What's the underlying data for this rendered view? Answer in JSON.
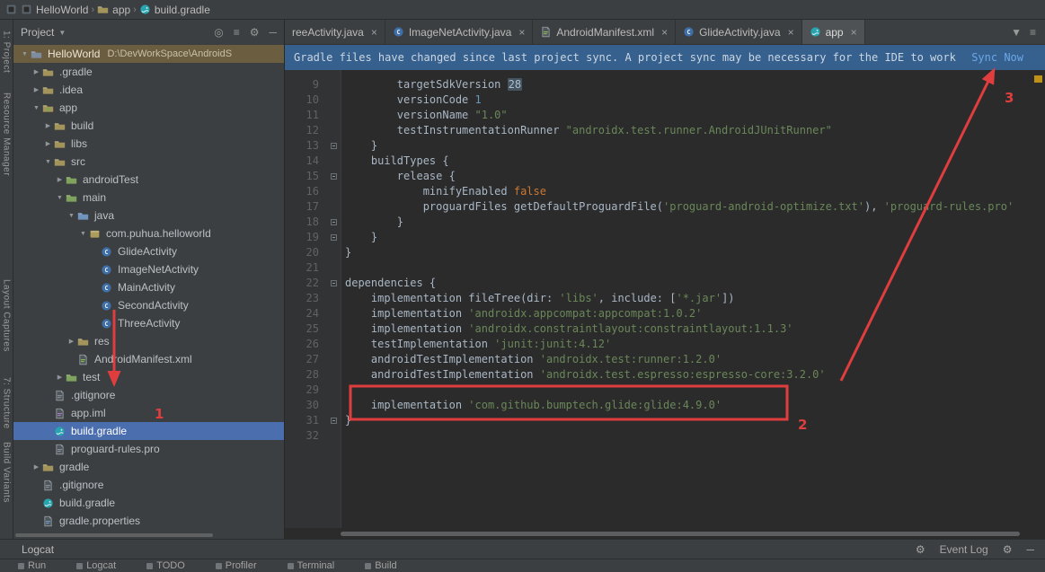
{
  "breadcrumb": {
    "items": [
      {
        "label": "HelloWorld",
        "icon": "project"
      },
      {
        "label": "app",
        "icon": "folder"
      },
      {
        "label": "build.gradle",
        "icon": "gradle"
      }
    ]
  },
  "left_strip": {
    "items": [
      "1: Project",
      "Resource Manager",
      "Layout Captures",
      "7: Structure",
      "Build Variants"
    ]
  },
  "project_panel": {
    "title": "Project",
    "tree": [
      {
        "label": "HelloWorld",
        "suffix": "D:\\DevWorkSpace\\AndroidS",
        "level": 0,
        "icon": "project-folder",
        "arrow": "down",
        "state": "context"
      },
      {
        "label": ".gradle",
        "level": 1,
        "icon": "folder",
        "arrow": "right"
      },
      {
        "label": ".idea",
        "level": 1,
        "icon": "folder",
        "arrow": "right"
      },
      {
        "label": "app",
        "level": 1,
        "icon": "module-folder",
        "arrow": "down"
      },
      {
        "label": "build",
        "level": 2,
        "icon": "folder",
        "arrow": "right"
      },
      {
        "label": "libs",
        "level": 2,
        "icon": "folder",
        "arrow": "right"
      },
      {
        "label": "src",
        "level": 2,
        "icon": "folder",
        "arrow": "down"
      },
      {
        "label": "androidTest",
        "level": 3,
        "icon": "folder-green",
        "arrow": "right"
      },
      {
        "label": "main",
        "level": 3,
        "icon": "folder-green",
        "arrow": "down"
      },
      {
        "label": "java",
        "level": 4,
        "icon": "folder-blue",
        "arrow": "down"
      },
      {
        "label": "com.puhua.helloworld",
        "level": 5,
        "icon": "package",
        "arrow": "down"
      },
      {
        "label": "GlideActivity",
        "level": 6,
        "icon": "class"
      },
      {
        "label": "ImageNetActivity",
        "level": 6,
        "icon": "class"
      },
      {
        "label": "MainActivity",
        "level": 6,
        "icon": "class"
      },
      {
        "label": "SecondActivity",
        "level": 6,
        "icon": "class"
      },
      {
        "label": "ThreeActivity",
        "level": 6,
        "icon": "class"
      },
      {
        "label": "res",
        "level": 4,
        "icon": "folder",
        "arrow": "right"
      },
      {
        "label": "AndroidManifest.xml",
        "level": 4,
        "icon": "manifest"
      },
      {
        "label": "test",
        "level": 3,
        "icon": "folder-green",
        "arrow": "right"
      },
      {
        "label": ".gitignore",
        "level": 2,
        "icon": "file"
      },
      {
        "label": "app.iml",
        "level": 2,
        "icon": "iml"
      },
      {
        "label": "build.gradle",
        "level": 2,
        "icon": "gradle",
        "state": "selected"
      },
      {
        "label": "proguard-rules.pro",
        "level": 2,
        "icon": "file"
      },
      {
        "label": "gradle",
        "level": 1,
        "icon": "folder",
        "arrow": "right"
      },
      {
        "label": ".gitignore",
        "level": 1,
        "icon": "file"
      },
      {
        "label": "build.gradle",
        "level": 1,
        "icon": "gradle"
      },
      {
        "label": "gradle.properties",
        "level": 1,
        "icon": "properties"
      }
    ]
  },
  "tabs": {
    "items": [
      {
        "label": "reeActivity.java",
        "icon": null,
        "active": false
      },
      {
        "label": "ImageNetActivity.java",
        "icon": "class",
        "active": false
      },
      {
        "label": "AndroidManifest.xml",
        "icon": "manifest",
        "active": false
      },
      {
        "label": "GlideActivity.java",
        "icon": "class",
        "active": false
      },
      {
        "label": "app",
        "icon": "gradle",
        "active": true
      }
    ]
  },
  "banner": {
    "message": "Gradle files have changed since last project sync. A project sync may be necessary for the IDE to work pr...",
    "action": "Sync Now"
  },
  "editor": {
    "lines": [
      {
        "no": 9,
        "fold": false,
        "segments": [
          [
            "plain",
            "        targetSdkVersion "
          ],
          [
            "hl",
            "28"
          ]
        ]
      },
      {
        "no": 10,
        "fold": false,
        "segments": [
          [
            "plain",
            "        versionCode "
          ],
          [
            "num",
            "1"
          ]
        ]
      },
      {
        "no": 11,
        "fold": false,
        "segments": [
          [
            "plain",
            "        versionName "
          ],
          [
            "str",
            "\"1.0\""
          ]
        ]
      },
      {
        "no": 12,
        "fold": false,
        "segments": [
          [
            "plain",
            "        testInstrumentationRunner "
          ],
          [
            "str",
            "\"androidx.test.runner.AndroidJUnitRunner\""
          ]
        ]
      },
      {
        "no": 13,
        "fold": true,
        "segments": [
          [
            "plain",
            "    }"
          ]
        ]
      },
      {
        "no": 14,
        "fold": false,
        "segments": [
          [
            "plain",
            "    buildTypes {"
          ]
        ]
      },
      {
        "no": 15,
        "fold": true,
        "segments": [
          [
            "plain",
            "        release {"
          ]
        ]
      },
      {
        "no": 16,
        "fold": false,
        "segments": [
          [
            "plain",
            "            minifyEnabled "
          ],
          [
            "kw",
            "false"
          ]
        ]
      },
      {
        "no": 17,
        "fold": false,
        "segments": [
          [
            "plain",
            "            proguardFiles getDefaultProguardFile("
          ],
          [
            "str",
            "'proguard-android-optimize.txt'"
          ],
          [
            "plain",
            "), "
          ],
          [
            "str",
            "'proguard-rules.pro'"
          ]
        ]
      },
      {
        "no": 18,
        "fold": true,
        "segments": [
          [
            "plain",
            "        }"
          ]
        ]
      },
      {
        "no": 19,
        "fold": true,
        "segments": [
          [
            "plain",
            "    }"
          ]
        ]
      },
      {
        "no": 20,
        "fold": false,
        "segments": [
          [
            "plain",
            "}"
          ]
        ]
      },
      {
        "no": 21,
        "fold": false,
        "segments": []
      },
      {
        "no": 22,
        "fold": true,
        "segments": [
          [
            "plain",
            "dependencies {"
          ]
        ]
      },
      {
        "no": 23,
        "fold": false,
        "segments": [
          [
            "plain",
            "    implementation fileTree(dir: "
          ],
          [
            "str",
            "'libs'"
          ],
          [
            "plain",
            ", include: ["
          ],
          [
            "str",
            "'*.jar'"
          ],
          [
            "plain",
            "])"
          ]
        ]
      },
      {
        "no": 24,
        "fold": false,
        "segments": [
          [
            "plain",
            "    implementation "
          ],
          [
            "str",
            "'androidx.appcompat:appcompat:1.0.2'"
          ]
        ]
      },
      {
        "no": 25,
        "fold": false,
        "segments": [
          [
            "plain",
            "    implementation "
          ],
          [
            "str",
            "'androidx.constraintlayout:constraintlayout:1.1.3'"
          ]
        ]
      },
      {
        "no": 26,
        "fold": false,
        "segments": [
          [
            "plain",
            "    testImplementation "
          ],
          [
            "str",
            "'junit:junit:4.12'"
          ]
        ]
      },
      {
        "no": 27,
        "fold": false,
        "segments": [
          [
            "plain",
            "    androidTestImplementation "
          ],
          [
            "str",
            "'androidx.test:runner:1.2.0'"
          ]
        ]
      },
      {
        "no": 28,
        "fold": false,
        "segments": [
          [
            "plain",
            "    androidTestImplementation "
          ],
          [
            "str",
            "'androidx.test.espresso:espresso-core:3.2.0'"
          ]
        ]
      },
      {
        "no": 29,
        "fold": false,
        "segments": []
      },
      {
        "no": 30,
        "fold": false,
        "segments": [
          [
            "plain",
            "    implementation "
          ],
          [
            "str",
            "'com.github.bumptech.glide:glide:4.9.0'"
          ]
        ]
      },
      {
        "no": 31,
        "fold": true,
        "segments": [
          [
            "plain",
            "}"
          ]
        ]
      },
      {
        "no": 32,
        "fold": false,
        "segments": []
      }
    ]
  },
  "status_bar": {
    "logcat": "Logcat",
    "event_log": "Event Log"
  },
  "bottom_strip": {
    "items": [
      "Run",
      "Logcat",
      "TODO",
      "Profiler",
      "Terminal",
      "Build"
    ]
  },
  "annotations": [
    {
      "label": "1"
    },
    {
      "label": "2"
    },
    {
      "label": "3"
    }
  ],
  "colors": {
    "annotation_red": "#E03E3E",
    "tree_selection_blue": "#4B6EAF",
    "tree_context_brown": "#6B5D40",
    "banner_blue": "#36618E",
    "link_blue": "#6CA6E8",
    "string_green": "#6A8759",
    "number_blue": "#6897BB",
    "keyword_orange": "#CC7832",
    "error_stripe_orange": "#BE9117"
  }
}
